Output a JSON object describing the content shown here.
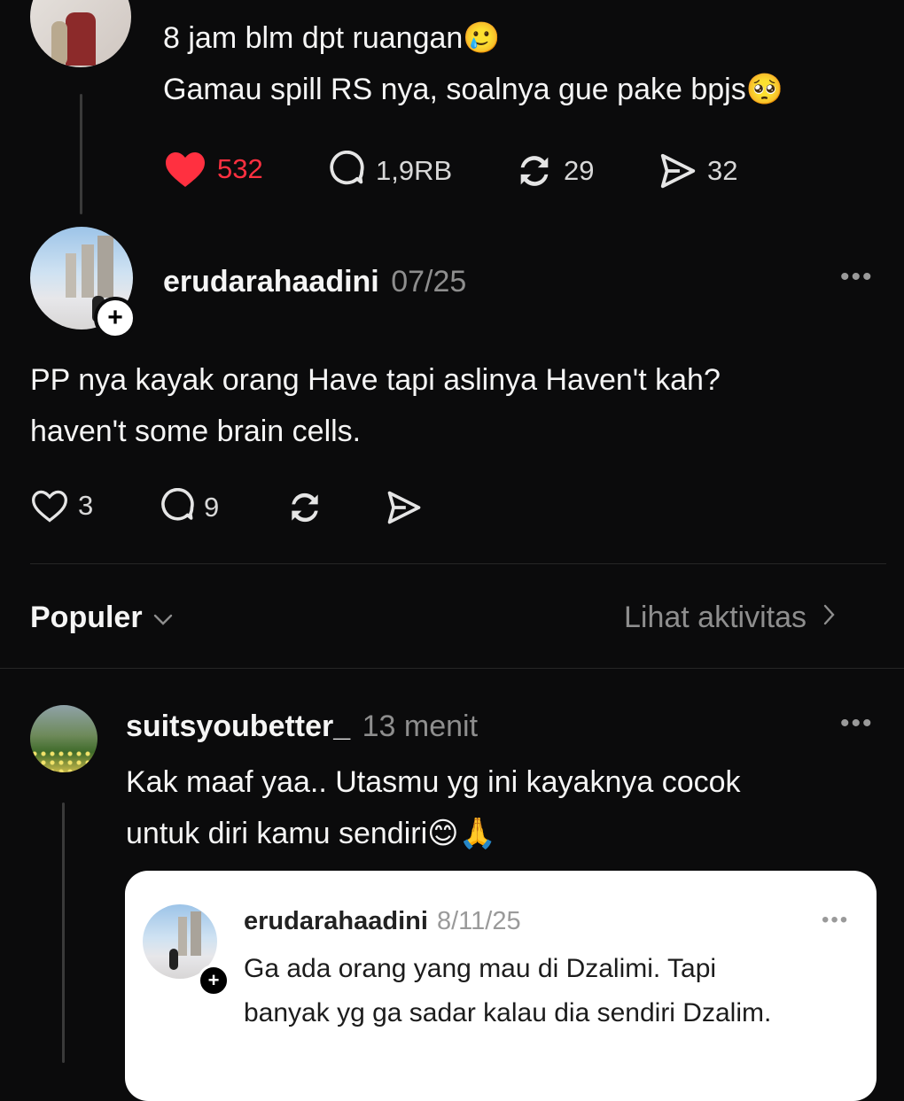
{
  "post1": {
    "line1": "8 jam blm dpt ruangan🥲",
    "line2": "Gamau spill RS nya, soalnya gue pake bpjs🥺",
    "likes": "532",
    "replies": "1,9RB",
    "reposts": "29",
    "shares": "32",
    "colors": {
      "like": "#ff3040"
    }
  },
  "post2": {
    "username": "erudarahaadini",
    "date": "07/25",
    "line1": "PP nya kayak orang Have tapi aslinya Haven't kah?",
    "line2": "haven't some brain cells.",
    "likes": "3",
    "replies": "9",
    "more": "..."
  },
  "sort": {
    "label": "Populer",
    "activity_link": "Lihat aktivitas"
  },
  "reply": {
    "username": "suitsyoubetter_",
    "time": "13 menit",
    "line1": "Kak maaf yaa.. Utasmu yg ini kayaknya cocok",
    "line2": "untuk diri kamu sendiri😊🙏",
    "more": "...",
    "quoted": {
      "username": "erudarahaadini",
      "date": "8/11/25",
      "line1": "Ga ada orang yang mau di Dzalimi. Tapi",
      "line2": "banyak yg ga sadar kalau dia sendiri Dzalim.",
      "more": "..."
    }
  }
}
